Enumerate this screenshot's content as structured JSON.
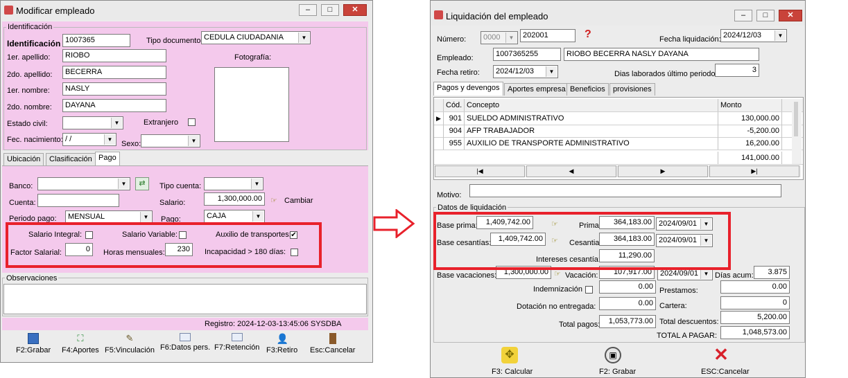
{
  "left": {
    "title": "Modificar empleado",
    "ident_group": "Identificación",
    "ident_label": "Identificación",
    "ident_value": "1007365",
    "tipo_doc_label": "Tipo documento:",
    "tipo_doc_value": "CEDULA CIUDADANIA",
    "apellido1_label": "1er. apellido:",
    "apellido1_value": "RIOBO",
    "apellido2_label": "2do. apellido:",
    "apellido2_value": "BECERRA",
    "nombre1_label": "1er. nombre:",
    "nombre1_value": "NASLY",
    "nombre2_label": "2do. nombre:",
    "nombre2_value": "DAYANA",
    "foto_label": "Fotografía:",
    "estado_civil_label": "Estado civil:",
    "estado_civil_value": "",
    "extranjero_label": "Extranjero",
    "fec_nac_label": "Fec. nacimiento:",
    "fec_nac_value": " / /",
    "sexo_label": "Sexo:",
    "sexo_value": "",
    "tabs": [
      "Ubicación",
      "Clasificación",
      "Pago"
    ],
    "banco_label": "Banco:",
    "banco_value": "",
    "tipo_cuenta_label": "Tipo cuenta:",
    "tipo_cuenta_value": "",
    "cuenta_label": "Cuenta:",
    "cuenta_value": "",
    "salario_label": "Salario:",
    "salario_value": "1,300,000.00",
    "cambiar_label": "Cambiar",
    "periodo_label": "Periodo pago:",
    "periodo_value": "MENSUAL",
    "pago_label": "Pago:",
    "pago_value": "CAJA",
    "salario_integral_label": "Salario Integral:",
    "salario_variable_label": "Salario Variable:",
    "auxilio_label": "Auxilio de transportes:",
    "factor_label": "Factor Salarial:",
    "factor_value": "0",
    "horas_label": "Horas mensuales:",
    "horas_value": "230",
    "incapacidad_label": "Incapacidad > 180 días:",
    "observaciones_label": "Observaciones",
    "registro_text": "Registro: 2024-12-03-13:45:06 SYSDBA",
    "toolbar": [
      "F2:Grabar",
      "F4:Aportes",
      "F5:Vinculación",
      "F6:Datos pers.",
      "F7:Retención",
      "F3:Retiro",
      "Esc:Cancelar"
    ]
  },
  "right": {
    "title": "Liquidación del empleado",
    "numero_label": "Número:",
    "numero_prefix": "0000",
    "numero_value": "202001",
    "help_glyph": "?",
    "fecha_liq_label": "Fecha liquidación:",
    "fecha_liq_value": "2024/12/03",
    "empleado_label": "Empleado:",
    "empleado_id": "1007365255",
    "empleado_nombre": "RIOBO BECERRA NASLY DAYANA",
    "fecha_retiro_label": "Fecha retiro:",
    "fecha_retiro_value": "2024/12/03",
    "dias_lab_label": "Dias laborados último periodo:",
    "dias_lab_value": "3",
    "tabs": [
      "Pagos y devengos",
      "Aportes empresa",
      "Beneficios",
      "provisiones"
    ],
    "grid_headers": [
      "Cód.",
      "Concepto",
      "Monto"
    ],
    "grid_rows": [
      {
        "cod": "901",
        "concepto": "SUELDO ADMINISTRATIVO",
        "monto": "130,000.00"
      },
      {
        "cod": "904",
        "concepto": "AFP TRABAJADOR",
        "monto": "-5,200.00"
      },
      {
        "cod": "955",
        "concepto": "AUXILIO DE TRANSPORTE ADMINISTRATIVO",
        "monto": "16,200.00"
      }
    ],
    "grid_total": "141,000.00",
    "motivo_label": "Motivo:",
    "motivo_value": "",
    "datos_label": "Datos de liquidación",
    "base_prima_label": "Base prima:",
    "base_prima_value": "1,409,742.00",
    "prima_label": "Prima:",
    "prima_value": "364,183.00",
    "prima_fecha": "2024/09/01",
    "base_ces_label": "Base cesantías:",
    "base_ces_value": "1,409,742.00",
    "ces_label": "Cesantia:",
    "ces_value": "364,183.00",
    "ces_fecha": "2024/09/01",
    "intereses_label": "Intereses cesantía:",
    "intereses_value": "11,290.00",
    "base_vac_label": "Base vacaciones:",
    "base_vac_value": "1,300,000.00",
    "vac_label": "Vacación:",
    "vac_value": "107,917.00",
    "vac_fecha": "2024/09/01",
    "dias_acum_label": "Días acum:",
    "dias_acum_value": "3.875",
    "indem_label": "Indemnización",
    "indem_value": "0.00",
    "prestamos_label": "Prestamos:",
    "prestamos_value": "0.00",
    "dotacion_label": "Dotación no entregada:",
    "dotacion_value": "0.00",
    "cartera_label": "Cartera:",
    "cartera_value": "0",
    "total_pagos_label": "Total pagos:",
    "total_pagos_value": "1,053,773.00",
    "total_desc_label": "Total descuentos:",
    "total_desc_value": "5,200.00",
    "total_pagar_label": "TOTAL A PAGAR:",
    "total_pagar_value": "1,048,573.00",
    "toolbar": [
      "F3: Calcular",
      "F2: Grabar",
      "ESC:Cancelar"
    ]
  },
  "colors": {
    "pink": "#f4c9ec",
    "highlight": "#e8212b",
    "close": "#c9433a"
  }
}
